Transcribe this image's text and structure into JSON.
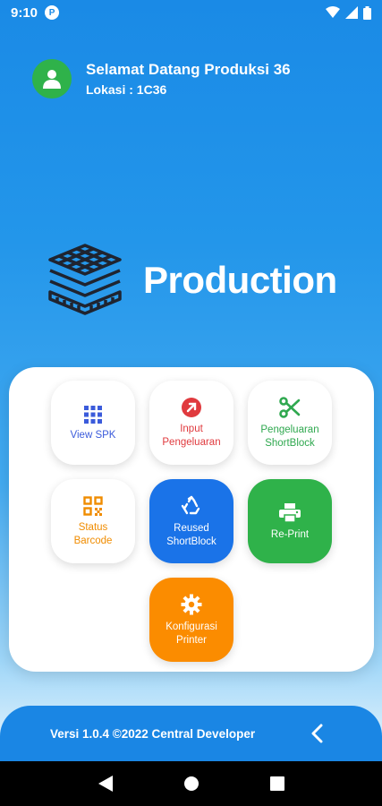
{
  "status_bar": {
    "time": "9:10",
    "app_icon_letter": "P"
  },
  "header": {
    "greeting": "Selamat Datang Produksi 36",
    "location": "Lokasi : 1C36"
  },
  "brand": {
    "title": "Production"
  },
  "menu": [
    {
      "label": "View SPK",
      "color": "#3b5bdb",
      "icon": "grid-icon"
    },
    {
      "label": "Input\nPengeluaran",
      "color": "#e03a3e",
      "icon": "arrow-up-right-icon"
    },
    {
      "label": "Pengeluaran\nShortBlock",
      "color": "#2fa84f",
      "icon": "scissors-icon"
    },
    {
      "label": "Status\nBarcode",
      "color": "#f08c00",
      "icon": "qr-code-icon"
    },
    {
      "label": "Reused\nShortBlock",
      "color": "#ffffff",
      "bg": "#1a73e8",
      "icon": "recycle-icon"
    },
    {
      "label": "Re-Print",
      "color": "#ffffff",
      "bg": "#2fb24a",
      "icon": "printer-icon"
    },
    {
      "label": "Konfigurasi\nPrinter",
      "color": "#ffffff",
      "bg": "#fb8c00",
      "icon": "gear-icon"
    }
  ],
  "footer": {
    "version": "Versi 1.0.4 ©2022 Central Developer"
  }
}
